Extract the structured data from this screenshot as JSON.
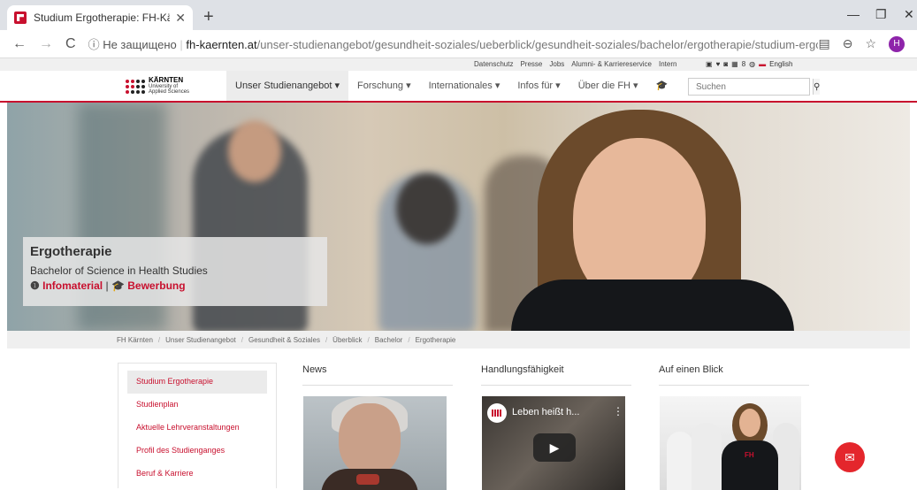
{
  "browser": {
    "tab_title": "Studium Ergotherapie: FH-Kärnte",
    "tab_close": "✕",
    "new_tab": "+",
    "url_security": "Не защищено",
    "url_host": "fh-kaernten.at",
    "url_path": "/unser-studienangebot/gesundheit-soziales/ueberblick/gesundheit-soziales/bachelor/ergotherapie/studium-ergotherapie/",
    "profile_initial": "H"
  },
  "utility_links": [
    "Datenschutz",
    "Presse",
    "Jobs",
    "Alumni- & Karriereservice",
    "Intern"
  ],
  "language": "English",
  "logo": {
    "name": "KÄRNTEN",
    "sub1": "University of",
    "sub2": "Applied Sciences"
  },
  "nav": {
    "items": [
      {
        "label": "Unser Studienangebot ▾"
      },
      {
        "label": "Forschung ▾"
      },
      {
        "label": "Internationales ▾"
      },
      {
        "label": "Infos für ▾"
      },
      {
        "label": "Über die FH ▾"
      }
    ],
    "search_placeholder": "Suchen"
  },
  "hero": {
    "title": "Ergotherapie",
    "subtitle": "Bachelor of Science in Health Studies",
    "link_info": "Infomaterial",
    "link_sep": "|",
    "link_apply": "Bewerbung"
  },
  "breadcrumb": [
    "FH Kärnten",
    "Unser Studienangebot",
    "Gesundheit & Soziales",
    "Überblick",
    "Bachelor",
    "Ergotherapie"
  ],
  "sidebar": {
    "items": [
      {
        "label": "Studium Ergotherapie"
      },
      {
        "label": "Studienplan"
      },
      {
        "label": "Aktuelle Lehrveranstaltungen"
      },
      {
        "label": "Profil des Studienganges"
      },
      {
        "label": "Beruf & Karriere"
      }
    ]
  },
  "columns": {
    "news": "News",
    "handlung": "Handlungsfähigkeit",
    "blick": "Auf einen Blick"
  },
  "video": {
    "title": "Leben heißt h..."
  },
  "colors": {
    "brand": "#c8102e",
    "fab": "#e4262c"
  }
}
